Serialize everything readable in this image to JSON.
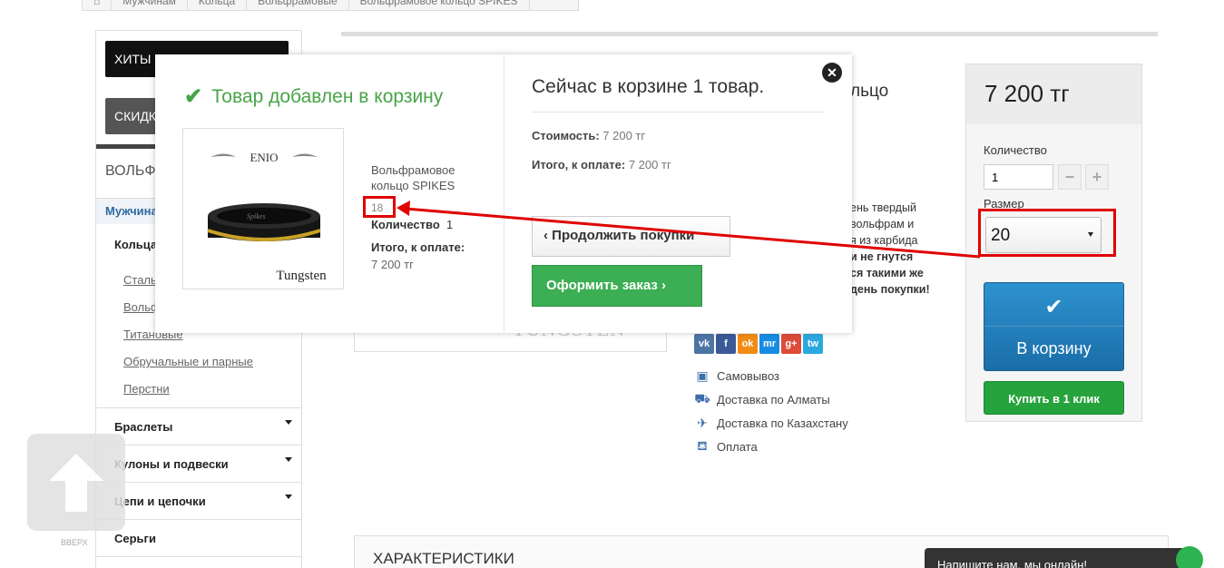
{
  "breadcrumb": [
    "⌂",
    "Мужчинам",
    "Кольца",
    "Вольфрамовые",
    "Вольфрамовое кольцо SPIKES"
  ],
  "sidebar": {
    "hits_btn": "ХИТЫ И",
    "sale_btn": "СКИДК",
    "heading": "ВОЛЬФ",
    "men": "Мужчина",
    "rings": "Кольца",
    "sub_links": [
      "Сталь",
      "Вольф",
      "Титановые",
      "Обручальные и парные",
      "Перстни"
    ],
    "categories": [
      "Браслеты",
      "Кулоны и подвески",
      "Цепи и цепочки",
      "Серьги"
    ]
  },
  "up_button": {
    "label": "ВВЕРХ"
  },
  "product": {
    "title_fragment": "льцо",
    "description_lines": [
      "ень твердый",
      "вольфрам и",
      "я из карбида",
      "и не гнутся",
      "ся такими же",
      "день покупки!"
    ],
    "brand_ghost": "TUNGSTEN",
    "social": [
      "vk",
      "f",
      "ok",
      "mr",
      "g+",
      "tw"
    ],
    "delivery": [
      {
        "icon": "pickup-icon",
        "text": "Самовывоз"
      },
      {
        "icon": "truck-icon",
        "text": "Доставка по Алматы"
      },
      {
        "icon": "plane-icon",
        "text": "Доставка по Казахстану"
      },
      {
        "icon": "payment-icon",
        "text": "Оплата"
      }
    ]
  },
  "price_box": {
    "price": "7 200 тг",
    "qty_label": "Количество",
    "qty_value": "1",
    "minus": "−",
    "plus": "+",
    "size_label": "Размер",
    "size_value": "20",
    "cart_label": "В корзину",
    "buy_one_click": "Купить в 1 клик"
  },
  "characteristics": {
    "title": "ХАРАКТЕРИСТИКИ"
  },
  "chat": {
    "text": "Напишите нам, мы онлайн!"
  },
  "modal": {
    "added_title": "Товар добавлен в корзину",
    "image_brand_top": "ENIO",
    "image_brand_bottom": "Tungsten",
    "image_ring_text": "Spikes",
    "product_name": "Вольфрамовое кольцо SPIKES",
    "product_size": "18",
    "qty_label": "Количество",
    "qty_value": "1",
    "total_label": "Итого, к оплате:",
    "total_value": "7 200 тг",
    "cart_title": "Сейчас в корзине 1 товар.",
    "cost_label": "Стоимость:",
    "cost_value": "7 200 тг",
    "total2_label": "Итого, к оплате:",
    "total2_value": "7 200 тг",
    "continue_label": "Продолжить покупки",
    "order_label": "Оформить заказ",
    "close": "✕"
  },
  "colors": {
    "accent_green": "#46a546",
    "button_green": "#3cae53",
    "cart_blue": "#2e92cf",
    "highlight_red": "#e00000"
  }
}
